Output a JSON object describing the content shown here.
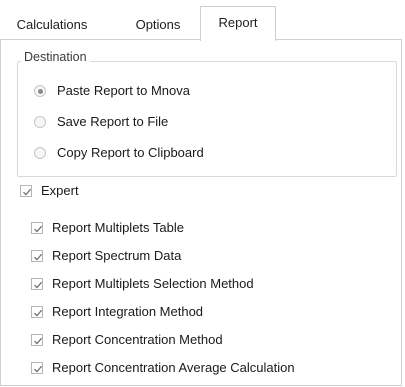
{
  "tabs": {
    "calculations": "Calculations",
    "options": "Options",
    "report": "Report"
  },
  "destination": {
    "legend": "Destination",
    "options": [
      {
        "label": "Paste Report to Mnova",
        "selected": true
      },
      {
        "label": "Save Report to File",
        "selected": false
      },
      {
        "label": "Copy Report to Clipboard",
        "selected": false
      }
    ]
  },
  "expert": {
    "label": "Expert",
    "checked": true
  },
  "report_options": [
    {
      "label": "Report Multiplets Table",
      "checked": true
    },
    {
      "label": "Report Spectrum Data",
      "checked": true
    },
    {
      "label": "Report Multiplets Selection Method",
      "checked": true
    },
    {
      "label": "Report Integration Method",
      "checked": true
    },
    {
      "label": "Report Concentration Method",
      "checked": true
    },
    {
      "label": "Report Concentration Average Calculation",
      "checked": true
    }
  ],
  "colors": {
    "check_mark": "#6a6a6a",
    "border": "#d0d0d0"
  }
}
